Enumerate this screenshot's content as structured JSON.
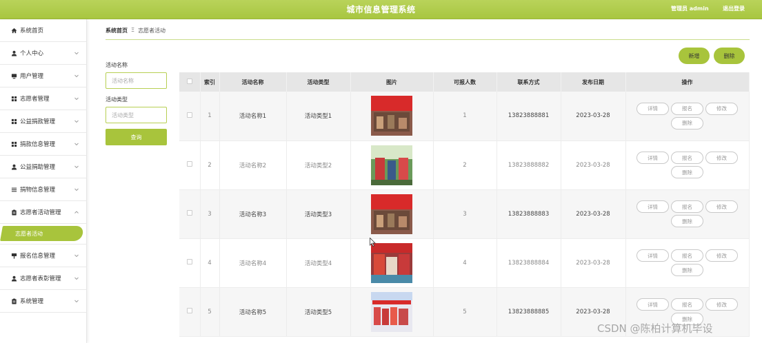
{
  "header": {
    "title": "城市信息管理系统",
    "admin_label": "管理员 admin",
    "logout_label": "退出登录"
  },
  "sidebar": {
    "items": [
      {
        "label": "系统首页",
        "icon": "home-icon",
        "chevron": false
      },
      {
        "label": "个人中心",
        "icon": "user-icon",
        "chevron": true
      },
      {
        "label": "用户管理",
        "icon": "monitor-icon",
        "chevron": true
      },
      {
        "label": "志愿者管理",
        "icon": "grid-icon",
        "chevron": true
      },
      {
        "label": "公益捐款管理",
        "icon": "grid-icon",
        "chevron": true
      },
      {
        "label": "捐款信息管理",
        "icon": "grid-icon",
        "chevron": true
      },
      {
        "label": "公益捐助管理",
        "icon": "user-icon",
        "chevron": true
      },
      {
        "label": "捐物信息管理",
        "icon": "list-icon",
        "chevron": true
      },
      {
        "label": "志愿者活动管理",
        "icon": "clipboard-icon",
        "chevron": true,
        "expanded": true
      }
    ],
    "sub_item": "志愿者活动",
    "items_after": [
      {
        "label": "报名信息管理",
        "icon": "pin-icon",
        "chevron": true
      },
      {
        "label": "志愿者表彰管理",
        "icon": "user-icon",
        "chevron": true
      },
      {
        "label": "系统管理",
        "icon": "clipboard-icon",
        "chevron": true
      }
    ]
  },
  "breadcrumb": {
    "home": "系统首页",
    "separator": "Ξ",
    "current": "志愿者活动"
  },
  "search": {
    "name_label": "活动名称",
    "name_placeholder": "活动名称",
    "type_label": "活动类型",
    "type_placeholder": "活动类型",
    "query_button": "查询"
  },
  "actions": {
    "add_label": "新增",
    "delete_label": "删除"
  },
  "table": {
    "columns": [
      "索引",
      "活动名称",
      "活动类型",
      "图片",
      "可报人数",
      "联系方式",
      "发布日期",
      "操作"
    ],
    "op_labels": {
      "detail": "详情",
      "signup": "报名",
      "edit": "修改",
      "delete": "删除"
    },
    "rows": [
      {
        "index": "1",
        "name": "活动名称1",
        "type": "活动类型1",
        "count": "1",
        "phone": "13823888881",
        "date": "2023-03-28"
      },
      {
        "index": "2",
        "name": "活动名称2",
        "type": "活动类型2",
        "count": "2",
        "phone": "13823888882",
        "date": "2023-03-28"
      },
      {
        "index": "3",
        "name": "活动名称3",
        "type": "活动类型3",
        "count": "3",
        "phone": "13823888883",
        "date": "2023-03-28"
      },
      {
        "index": "4",
        "name": "活动名称4",
        "type": "活动类型4",
        "count": "4",
        "phone": "13823888884",
        "date": "2023-03-28"
      },
      {
        "index": "5",
        "name": "活动名称5",
        "type": "活动类型5",
        "count": "5",
        "phone": "13823888885",
        "date": "2023-03-28"
      }
    ]
  },
  "watermark": "CSDN @陈柏计算机毕设",
  "colors": {
    "accent": "#a8c43c",
    "header": "#b0cc4c"
  }
}
